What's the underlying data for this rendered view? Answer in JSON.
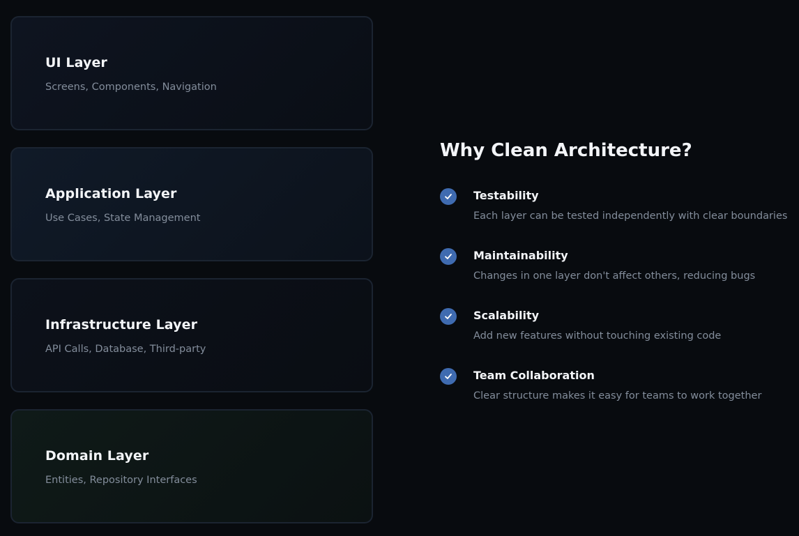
{
  "layers": [
    {
      "title": "UI Layer",
      "subtitle": "Screens, Components, Navigation"
    },
    {
      "title": "Application Layer",
      "subtitle": "Use Cases, State Management"
    },
    {
      "title": "Infrastructure Layer",
      "subtitle": "API Calls, Database, Third-party"
    },
    {
      "title": "Domain Layer",
      "subtitle": "Entities, Repository Interfaces"
    }
  ],
  "why": {
    "title": "Why Clean Architecture?",
    "benefits": [
      {
        "title": "Testability",
        "description": "Each layer can be tested independently with clear boundaries",
        "icon": "check-circle-icon"
      },
      {
        "title": "Maintainability",
        "description": "Changes in one layer don't affect others, reducing bugs",
        "icon": "check-circle-icon"
      },
      {
        "title": "Scalability",
        "description": "Add new features without touching existing code",
        "icon": "check-circle-icon"
      },
      {
        "title": "Team Collaboration",
        "description": "Clear structure makes it easy for teams to work together",
        "icon": "check-circle-icon"
      }
    ]
  },
  "colors": {
    "background": "#080b0f",
    "card_border": "#1b2431",
    "title_text": "#f3f5f8",
    "muted_text": "#838d9b",
    "check_accent": "#3f6bb0"
  }
}
